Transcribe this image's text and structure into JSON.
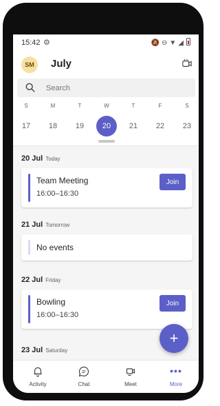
{
  "status_bar": {
    "time": "15:42"
  },
  "header": {
    "avatar_initials": "SM",
    "month": "July"
  },
  "search": {
    "placeholder": "Search"
  },
  "week": {
    "days": [
      {
        "letter": "S",
        "date": "17"
      },
      {
        "letter": "M",
        "date": "18"
      },
      {
        "letter": "T",
        "date": "19"
      },
      {
        "letter": "W",
        "date": "20",
        "selected": true
      },
      {
        "letter": "T",
        "date": "21"
      },
      {
        "letter": "F",
        "date": "22"
      },
      {
        "letter": "S",
        "date": "23"
      }
    ]
  },
  "agenda": [
    {
      "date": "20 Jul",
      "relative": "Today",
      "event": {
        "title": "Team Meeting",
        "time": "16:00–16:30",
        "join_label": "Join"
      }
    },
    {
      "date": "21 Jul",
      "relative": "Tomorrow",
      "empty_text": "No events"
    },
    {
      "date": "22 Jul",
      "relative": "Friday",
      "event": {
        "title": "Bowling",
        "time": "16:00–16:30",
        "join_label": "Join"
      }
    },
    {
      "date": "23 Jul",
      "relative": "Saturday"
    }
  ],
  "fab": {
    "label": "+"
  },
  "nav": {
    "items": [
      {
        "label": "Activity",
        "icon": "bell-icon"
      },
      {
        "label": "Chat",
        "icon": "chat-icon"
      },
      {
        "label": "Meet",
        "icon": "meet-icon"
      },
      {
        "label": "More",
        "icon": "more-icon",
        "dots": "•••",
        "active": true
      }
    ]
  },
  "colors": {
    "accent": "#5b5fc7",
    "avatar_bg": "#f6e0a3"
  }
}
